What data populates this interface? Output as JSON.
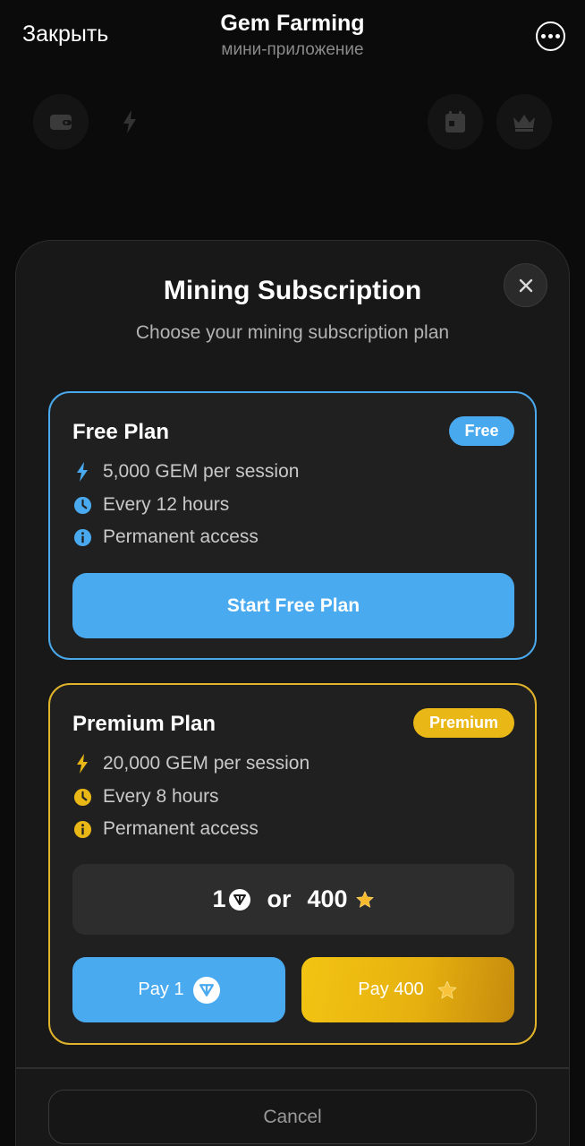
{
  "header": {
    "close_label": "Закрыть",
    "title": "Gem Farming",
    "subtitle": "мини-приложение"
  },
  "toolbar": {
    "icons": [
      "wallet-icon",
      "lightning-icon",
      "calendar-icon",
      "crown-icon"
    ]
  },
  "modal": {
    "title": "Mining Subscription",
    "subtitle": "Choose your mining subscription plan",
    "free_plan": {
      "name": "Free Plan",
      "badge": "Free",
      "features": [
        {
          "icon": "lightning-icon",
          "text": "5,000 GEM per session"
        },
        {
          "icon": "clock-icon",
          "text": "Every 12 hours"
        },
        {
          "icon": "info-icon",
          "text": "Permanent access"
        }
      ],
      "button_label": "Start Free Plan"
    },
    "premium_plan": {
      "name": "Premium Plan",
      "badge": "Premium",
      "features": [
        {
          "icon": "lightning-icon",
          "text": "20,000 GEM per session"
        },
        {
          "icon": "clock-icon",
          "text": "Every 8 hours"
        },
        {
          "icon": "info-icon",
          "text": "Permanent access"
        }
      ],
      "price_ton": "1",
      "price_or": "or",
      "price_stars": "400",
      "pay_ton_label": "Pay 1",
      "pay_stars_label": "Pay 400"
    },
    "cancel_label": "Cancel"
  },
  "colors": {
    "free_accent": "#4aaaf0",
    "premium_accent": "#e9b716",
    "background": "#0b0b0b",
    "card": "#202020"
  }
}
